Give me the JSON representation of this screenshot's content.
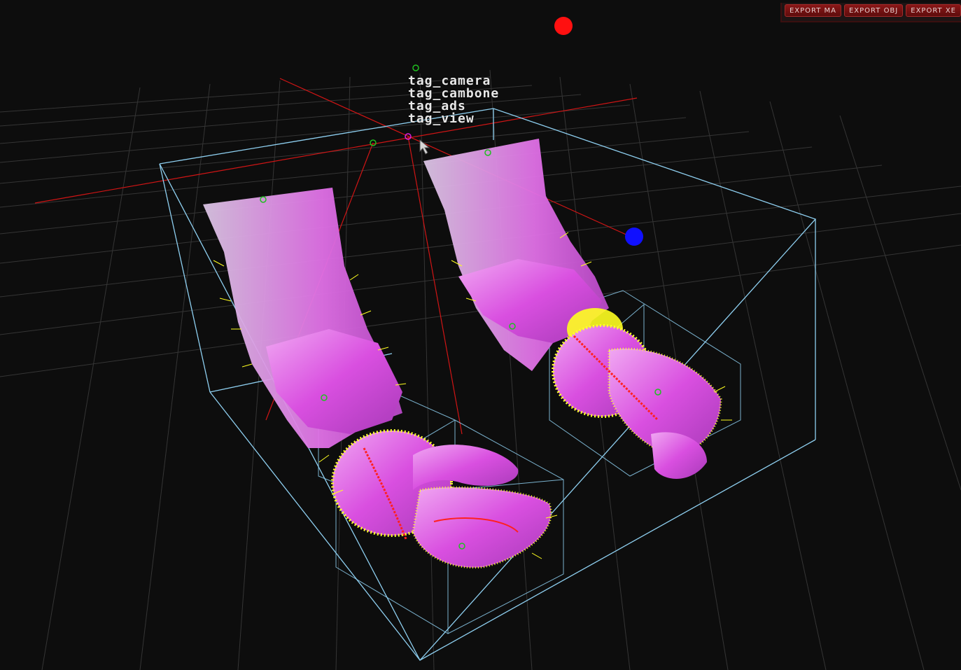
{
  "toolbar": {
    "export_ma_label": "EXPORT MA",
    "export_obj_label": "EXPORT OBJ",
    "export_xe_label": "EXPORT XE"
  },
  "tags": [
    "tag_camera",
    "tag_cambone",
    "tag_ads",
    "tag_view"
  ],
  "colors": {
    "background": "#0d0d0d",
    "grid": "#3a3a3a",
    "bounding_box": "#8ecff0",
    "axis_red": "#e01010",
    "light_red": "#ff1010",
    "light_blue": "#1010ff",
    "mesh": "#d94fe0",
    "normals_yellow": "#ffff00",
    "bone_green": "#20c020"
  },
  "icons": [
    "light-red-icon",
    "light-blue-icon",
    "mouse-cursor-icon",
    "bone-joint-icon"
  ]
}
